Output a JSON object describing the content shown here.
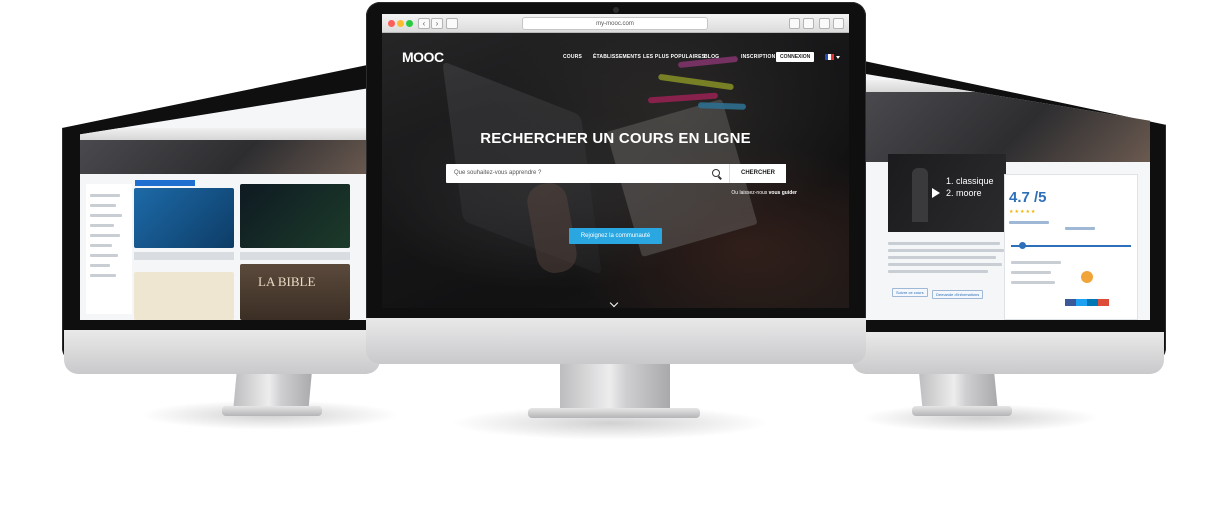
{
  "center": {
    "browser": {
      "url": "my-mooc.com"
    },
    "header": {
      "logo": "MOOC",
      "nav": [
        "COURS",
        "ÉTABLISSEMENTS",
        "LES PLUS POPULAIRES",
        "BLOG"
      ],
      "inscription": "INSCRIPTION",
      "connexion": "CONNEXION",
      "language_flag": "flag-fr-icon"
    },
    "hero": {
      "title": "RECHERCHER UN COURS EN LIGNE",
      "search_placeholder": "Que souhaitez-vous apprendre ?",
      "search_button": "CHERCHER",
      "guide_prefix": "Ou laissez-nous",
      "guide_link": "vous guider",
      "cta": "Rejoignez la communauté"
    }
  },
  "left": {
    "tile_captions": [
      "LA BIBLE"
    ]
  },
  "right": {
    "video_title_line1": "1. classique",
    "video_title_line2": "2. moore",
    "rating": "4.7 /5",
    "buttons": [
      "Suivre ce cours",
      "Demande d'informations"
    ]
  },
  "colors": {
    "accent": "#2aa7e0",
    "rating_blue": "#2d6fb8"
  }
}
